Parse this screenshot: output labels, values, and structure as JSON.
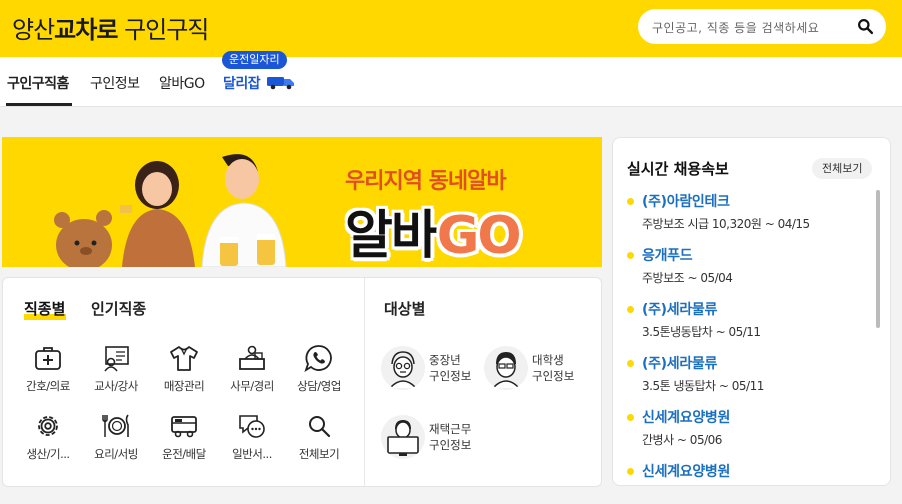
{
  "header": {
    "brand_prefix": "양산",
    "brand_bold": "교차로",
    "brand_suffix": "구인구직",
    "search_placeholder": "구인공고, 직종 등을 검색하세요",
    "accent": "#ffd800"
  },
  "nav": {
    "items": [
      "구인구직홈",
      "구인정보",
      "알바GO",
      "달리잡"
    ],
    "badge": "운전일자리"
  },
  "banner": {
    "line1": "우리지역 동네알바",
    "line2_a": "알바",
    "line2_b": "GO"
  },
  "jobs": {
    "tabs": [
      "직종별",
      "인기직종"
    ],
    "categories": [
      {
        "label": "간호/의료",
        "icon": "medical-kit-icon"
      },
      {
        "label": "교사/강사",
        "icon": "teacher-board-icon"
      },
      {
        "label": "매장관리",
        "icon": "shirt-icon"
      },
      {
        "label": "사무/경리",
        "icon": "office-desk-icon"
      },
      {
        "label": "상담/영업",
        "icon": "phone-chat-icon"
      },
      {
        "label": "생산/기...",
        "icon": "gear-icon"
      },
      {
        "label": "요리/서빙",
        "icon": "utensils-icon"
      },
      {
        "label": "운전/배달",
        "icon": "truck-icon"
      },
      {
        "label": "일반서...",
        "icon": "chat-bubble-icon"
      },
      {
        "label": "전체보기",
        "icon": "search-icon"
      }
    ]
  },
  "targets": {
    "title": "대상별",
    "items": [
      {
        "line1": "중장년",
        "line2": "구인정보",
        "icon": "senior-avatar-icon"
      },
      {
        "line1": "대학생",
        "line2": "구인정보",
        "icon": "student-avatar-icon"
      },
      {
        "line1": "재택근무",
        "line2": "구인정보",
        "icon": "remote-worker-icon"
      }
    ]
  },
  "realtime": {
    "title": "실시간 채용속보",
    "view_all": "전체보기",
    "items": [
      {
        "company": "(주)아람인테크",
        "detail": "주방보조 시급 10,320원 ~ 04/15"
      },
      {
        "company": "응개푸드",
        "detail": "주방보조 ~ 05/04"
      },
      {
        "company": "(주)세라물류",
        "detail": "3.5톤냉동탑차 ~ 05/11"
      },
      {
        "company": "(주)세라물류",
        "detail": "3.5톤 냉동탑차 ~ 05/11"
      },
      {
        "company": "신세계요양병원",
        "detail": "간병사 ~ 05/06"
      },
      {
        "company": "신세계요양병원",
        "detail": ""
      }
    ]
  }
}
